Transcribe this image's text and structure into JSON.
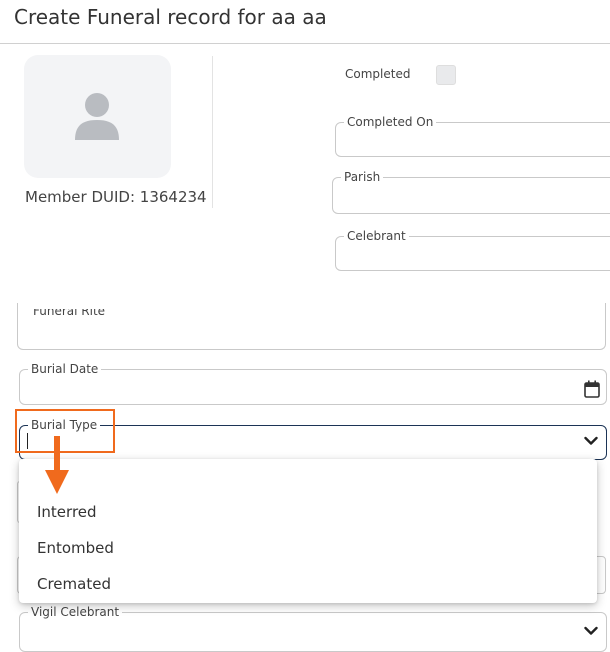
{
  "header": {
    "title": "Create Funeral record for aa aa"
  },
  "member": {
    "duid_label": "Member DUID: 1364234",
    "avatar_icon": "user-silhouette-icon"
  },
  "form": {
    "completed_label": "Completed",
    "completed_on_label": "Completed On",
    "parish_label": "Parish",
    "celebrant_label": "Celebrant",
    "funeral_rite_label": "Funeral Rite",
    "burial_date_label": "Burial Date",
    "burial_type_label": "Burial Type",
    "vigil_celebrant_label": "Vigil Celebrant"
  },
  "burial_type_options": [
    "Interred",
    "Entombed",
    "Cremated"
  ],
  "colors": {
    "highlight": "#f06a1d",
    "focus_border": "#1c3456"
  }
}
